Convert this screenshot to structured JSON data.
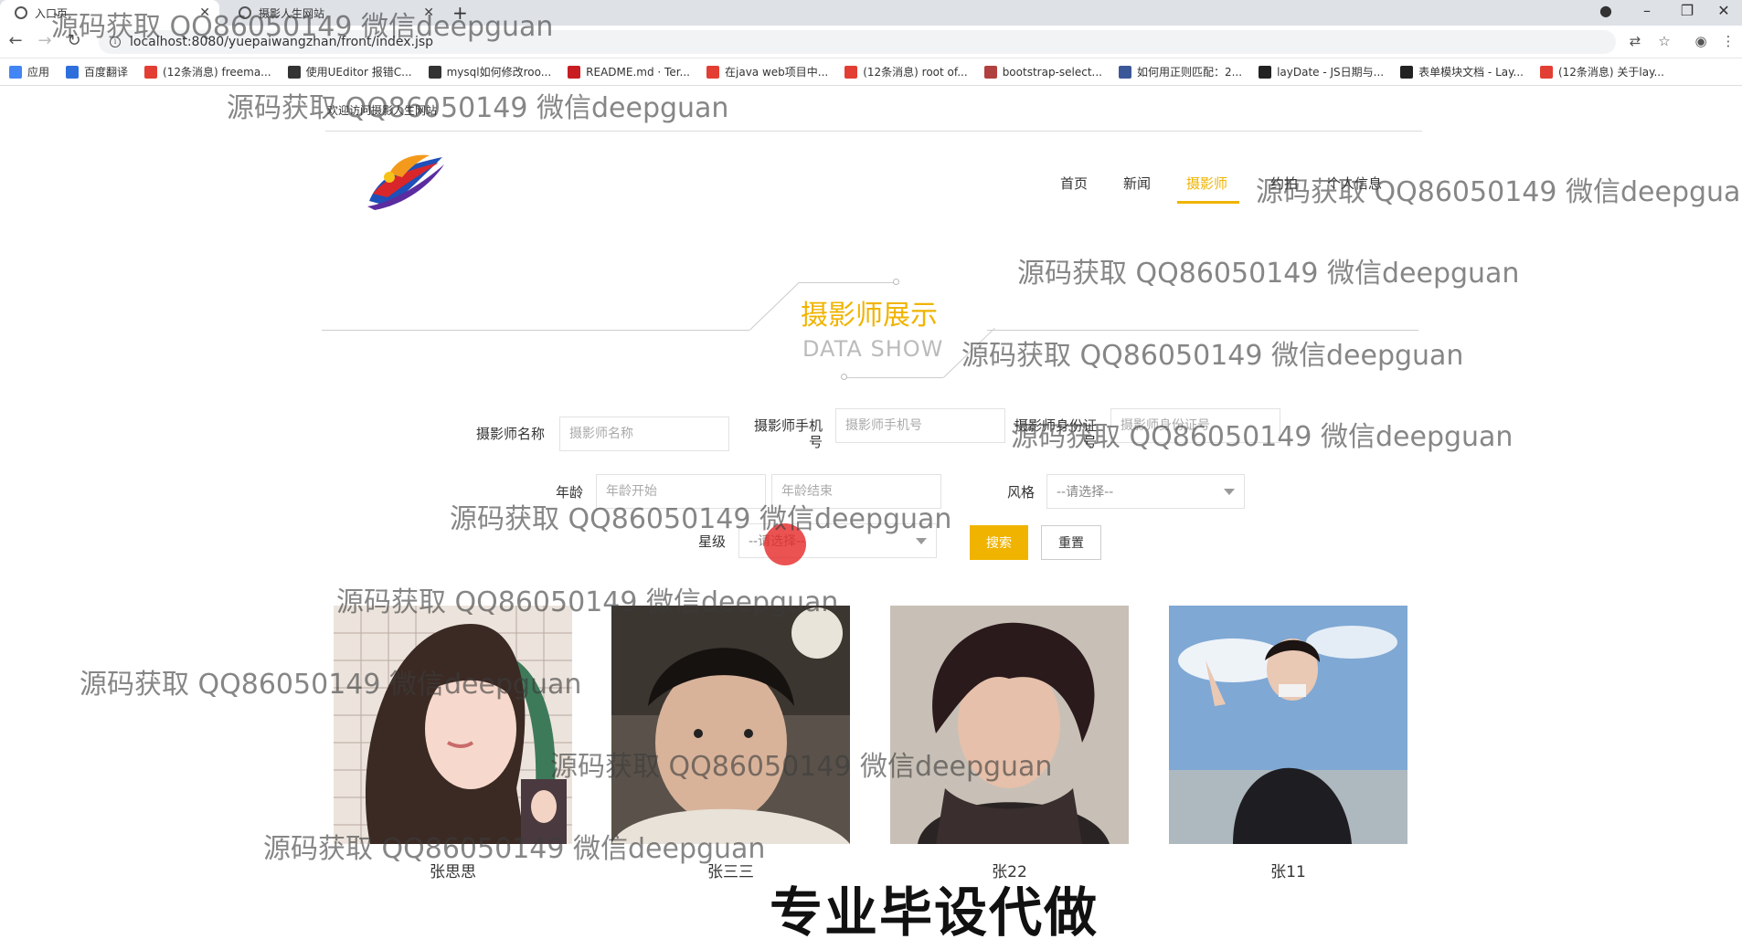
{
  "browser": {
    "tabs": [
      {
        "title": "入口页",
        "active": true
      },
      {
        "title": "摄影人生网站",
        "active": false
      }
    ],
    "new_tab": "+",
    "url": "localhost:8080/yuepaiwangzhan/front/index.jsp",
    "window_controls": [
      "–",
      "❐",
      "✕"
    ],
    "bookmarks": [
      {
        "label": "应用",
        "icon": "apps-grid-icon",
        "color": "#4285f4"
      },
      {
        "label": "百度翻译",
        "icon": "baidu-translate-icon",
        "color": "#2f6fdc"
      },
      {
        "label": "(12条消息) freema...",
        "icon": "csdn-icon",
        "color": "#e33e33"
      },
      {
        "label": "使用UEditor 报错C...",
        "icon": "cnblogs-icon",
        "color": "#333333"
      },
      {
        "label": "mysql如何修改roo...",
        "icon": "cnblogs-icon",
        "color": "#333333"
      },
      {
        "label": "README.md · Ter...",
        "icon": "gitee-icon",
        "color": "#c71d23"
      },
      {
        "label": "在java web项目中...",
        "icon": "csdn-icon",
        "color": "#e33e33"
      },
      {
        "label": "(12条消息) root of...",
        "icon": "csdn-icon",
        "color": "#e33e33"
      },
      {
        "label": "bootstrap-select...",
        "icon": "site-icon",
        "color": "#b0413e"
      },
      {
        "label": "如何用正则匹配：2...",
        "icon": "paw-icon",
        "color": "#3b5998"
      },
      {
        "label": "layDate - JS日期与...",
        "icon": "layui-icon",
        "color": "#222222"
      },
      {
        "label": "表单模块文档 - Lay...",
        "icon": "layui-icon",
        "color": "#222222"
      },
      {
        "label": "(12条消息) 关于lay...",
        "icon": "csdn-icon",
        "color": "#e33e33"
      }
    ]
  },
  "page": {
    "welcome": "欢迎访问摄影人生网站",
    "nav": [
      {
        "label": "首页",
        "active": false
      },
      {
        "label": "新闻",
        "active": false
      },
      {
        "label": "摄影师",
        "active": true
      },
      {
        "label": "约拍",
        "active": false
      },
      {
        "label": "个人信息",
        "active": false
      }
    ],
    "section": {
      "title": "摄影师展示",
      "subtitle": "DATA SHOW"
    },
    "filters": {
      "name_label": "摄影师名称",
      "name_placeholder": "摄影师名称",
      "phone_label": "摄影师手机号",
      "phone_placeholder": "摄影师手机号",
      "idcard_label": "摄影师身份证号",
      "idcard_placeholder": "摄影师身份证号",
      "age_label": "年龄",
      "age_start_placeholder": "年龄开始",
      "age_end_placeholder": "年龄结束",
      "style_label": "风格",
      "style_value": "--请选择--",
      "star_label": "星级",
      "star_value": "--请选择--",
      "search_button": "搜索",
      "reset_button": "重置"
    },
    "photographers": [
      {
        "name": "张思思"
      },
      {
        "name": "张三三"
      },
      {
        "name": "张22"
      },
      {
        "name": "张11"
      }
    ]
  },
  "overlay": {
    "watermark": "源码获取 QQ86050149 微信deepguan",
    "banner": "专业毕设代做"
  },
  "colors": {
    "accent": "#f0b400",
    "cursor_highlight": "#e62828"
  }
}
